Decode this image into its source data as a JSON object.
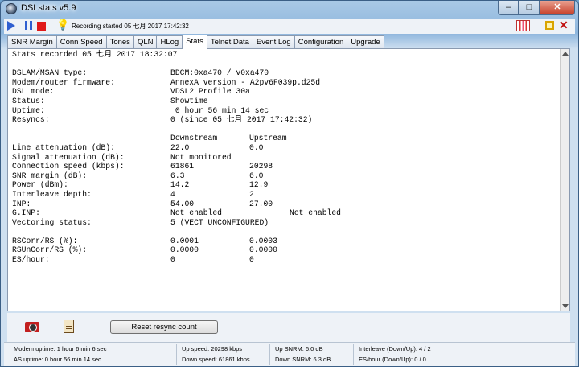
{
  "window": {
    "title": "DSLstats v5.9",
    "min": "–",
    "max": "□",
    "close": "✕"
  },
  "toolbar": {
    "recording_text": "Recording started 05 七月 2017 17:42:32",
    "close_icon": "✕"
  },
  "tabs": [
    "SNR Margin",
    "Conn Speed",
    "Tones",
    "QLN",
    "HLog",
    "Stats",
    "Telnet Data",
    "Event Log",
    "Configuration",
    "Upgrade"
  ],
  "active_tab": "Stats",
  "stats": {
    "recorded": "Stats recorded 05 七月 2017 18:32:07",
    "info_rows": [
      {
        "label": "DSLAM/MSAN type:",
        "value": "BDCM:0xa470 / v0xa470"
      },
      {
        "label": "Modem/router firmware:",
        "value": "AnnexA version - A2pv6F039p.d25d"
      },
      {
        "label": "DSL mode:",
        "value": "VDSL2 Profile 30a"
      },
      {
        "label": "Status:",
        "value": "Showtime"
      },
      {
        "label": "Uptime:",
        "value": " 0 hour 56 min 14 sec"
      },
      {
        "label": "Resyncs:",
        "value": "0 (since 05 七月 2017 17:42:32)"
      }
    ],
    "headers": {
      "downstream": "Downstream",
      "upstream": "Upstream"
    },
    "line_rows": [
      {
        "label": "Line attenuation (dB):",
        "down": "22.0",
        "up": "0.0",
        "extra": ""
      },
      {
        "label": "Signal attenuation (dB):",
        "down": "Not monitored",
        "up": "",
        "extra": ""
      },
      {
        "label": "Connection speed (kbps):",
        "down": "61861",
        "up": "20298",
        "extra": ""
      },
      {
        "label": "SNR margin (dB):",
        "down": "6.3",
        "up": "6.0",
        "extra": ""
      },
      {
        "label": "Power (dBm):",
        "down": "14.2",
        "up": "12.9",
        "extra": ""
      },
      {
        "label": "Interleave depth:",
        "down": "4",
        "up": "2",
        "extra": ""
      },
      {
        "label": "INP:",
        "down": "54.00",
        "up": "27.00",
        "extra": ""
      },
      {
        "label": "G.INP:",
        "down": "Not enabled",
        "up": "",
        "extra": "Not enabled"
      },
      {
        "label": "Vectoring status:",
        "down": "5 (VECT_UNCONFIGURED)",
        "up": "",
        "extra": ""
      }
    ],
    "err_rows": [
      {
        "label": "RSCorr/RS (%):",
        "down": "0.0001",
        "up": "0.0003"
      },
      {
        "label": "RSUnCorr/RS (%):",
        "down": "0.0000",
        "up": "0.0000"
      },
      {
        "label": "ES/hour:",
        "down": "0",
        "up": "0"
      }
    ]
  },
  "bottom": {
    "reset_label": "Reset resync count"
  },
  "status": {
    "modem_uptime": "Modem uptime:  1 hour 6 min 6 sec",
    "as_uptime": "AS uptime:  0 hour 56 min 14 sec",
    "up_speed": "Up speed: 20298 kbps",
    "down_speed": "Down speed: 61861 kbps",
    "up_snrm": "Up SNRM: 6.0 dB",
    "down_snrm": "Down SNRM: 6.3 dB",
    "interleave": "Interleave (Down/Up): 4 / 2",
    "es_hour": "ES/hour (Down/Up): 0 / 0"
  }
}
